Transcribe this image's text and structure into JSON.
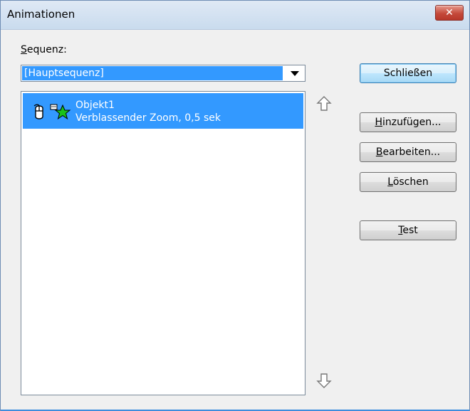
{
  "window": {
    "title": "Animationen",
    "close_label": "✕"
  },
  "sequence": {
    "label": "Sequenz:",
    "selected": "[Hauptsequenz]"
  },
  "list": {
    "items": [
      {
        "name": "Objekt1",
        "description": "Verblassender Zoom, 0,5 sek"
      }
    ]
  },
  "buttons": {
    "close": "Schließen",
    "add": "Hinzufügen...",
    "edit": "Bearbeiten...",
    "delete": "Löschen",
    "test": "Test"
  },
  "colors": {
    "selection": "#3399ff",
    "dialog_bg": "#f0f0f0",
    "close_button": "#c4493a"
  },
  "icons": {
    "move_up": "up-arrow-icon",
    "move_down": "down-arrow-icon",
    "trigger": "mouse-icon",
    "effect": "star-effect-icon"
  }
}
